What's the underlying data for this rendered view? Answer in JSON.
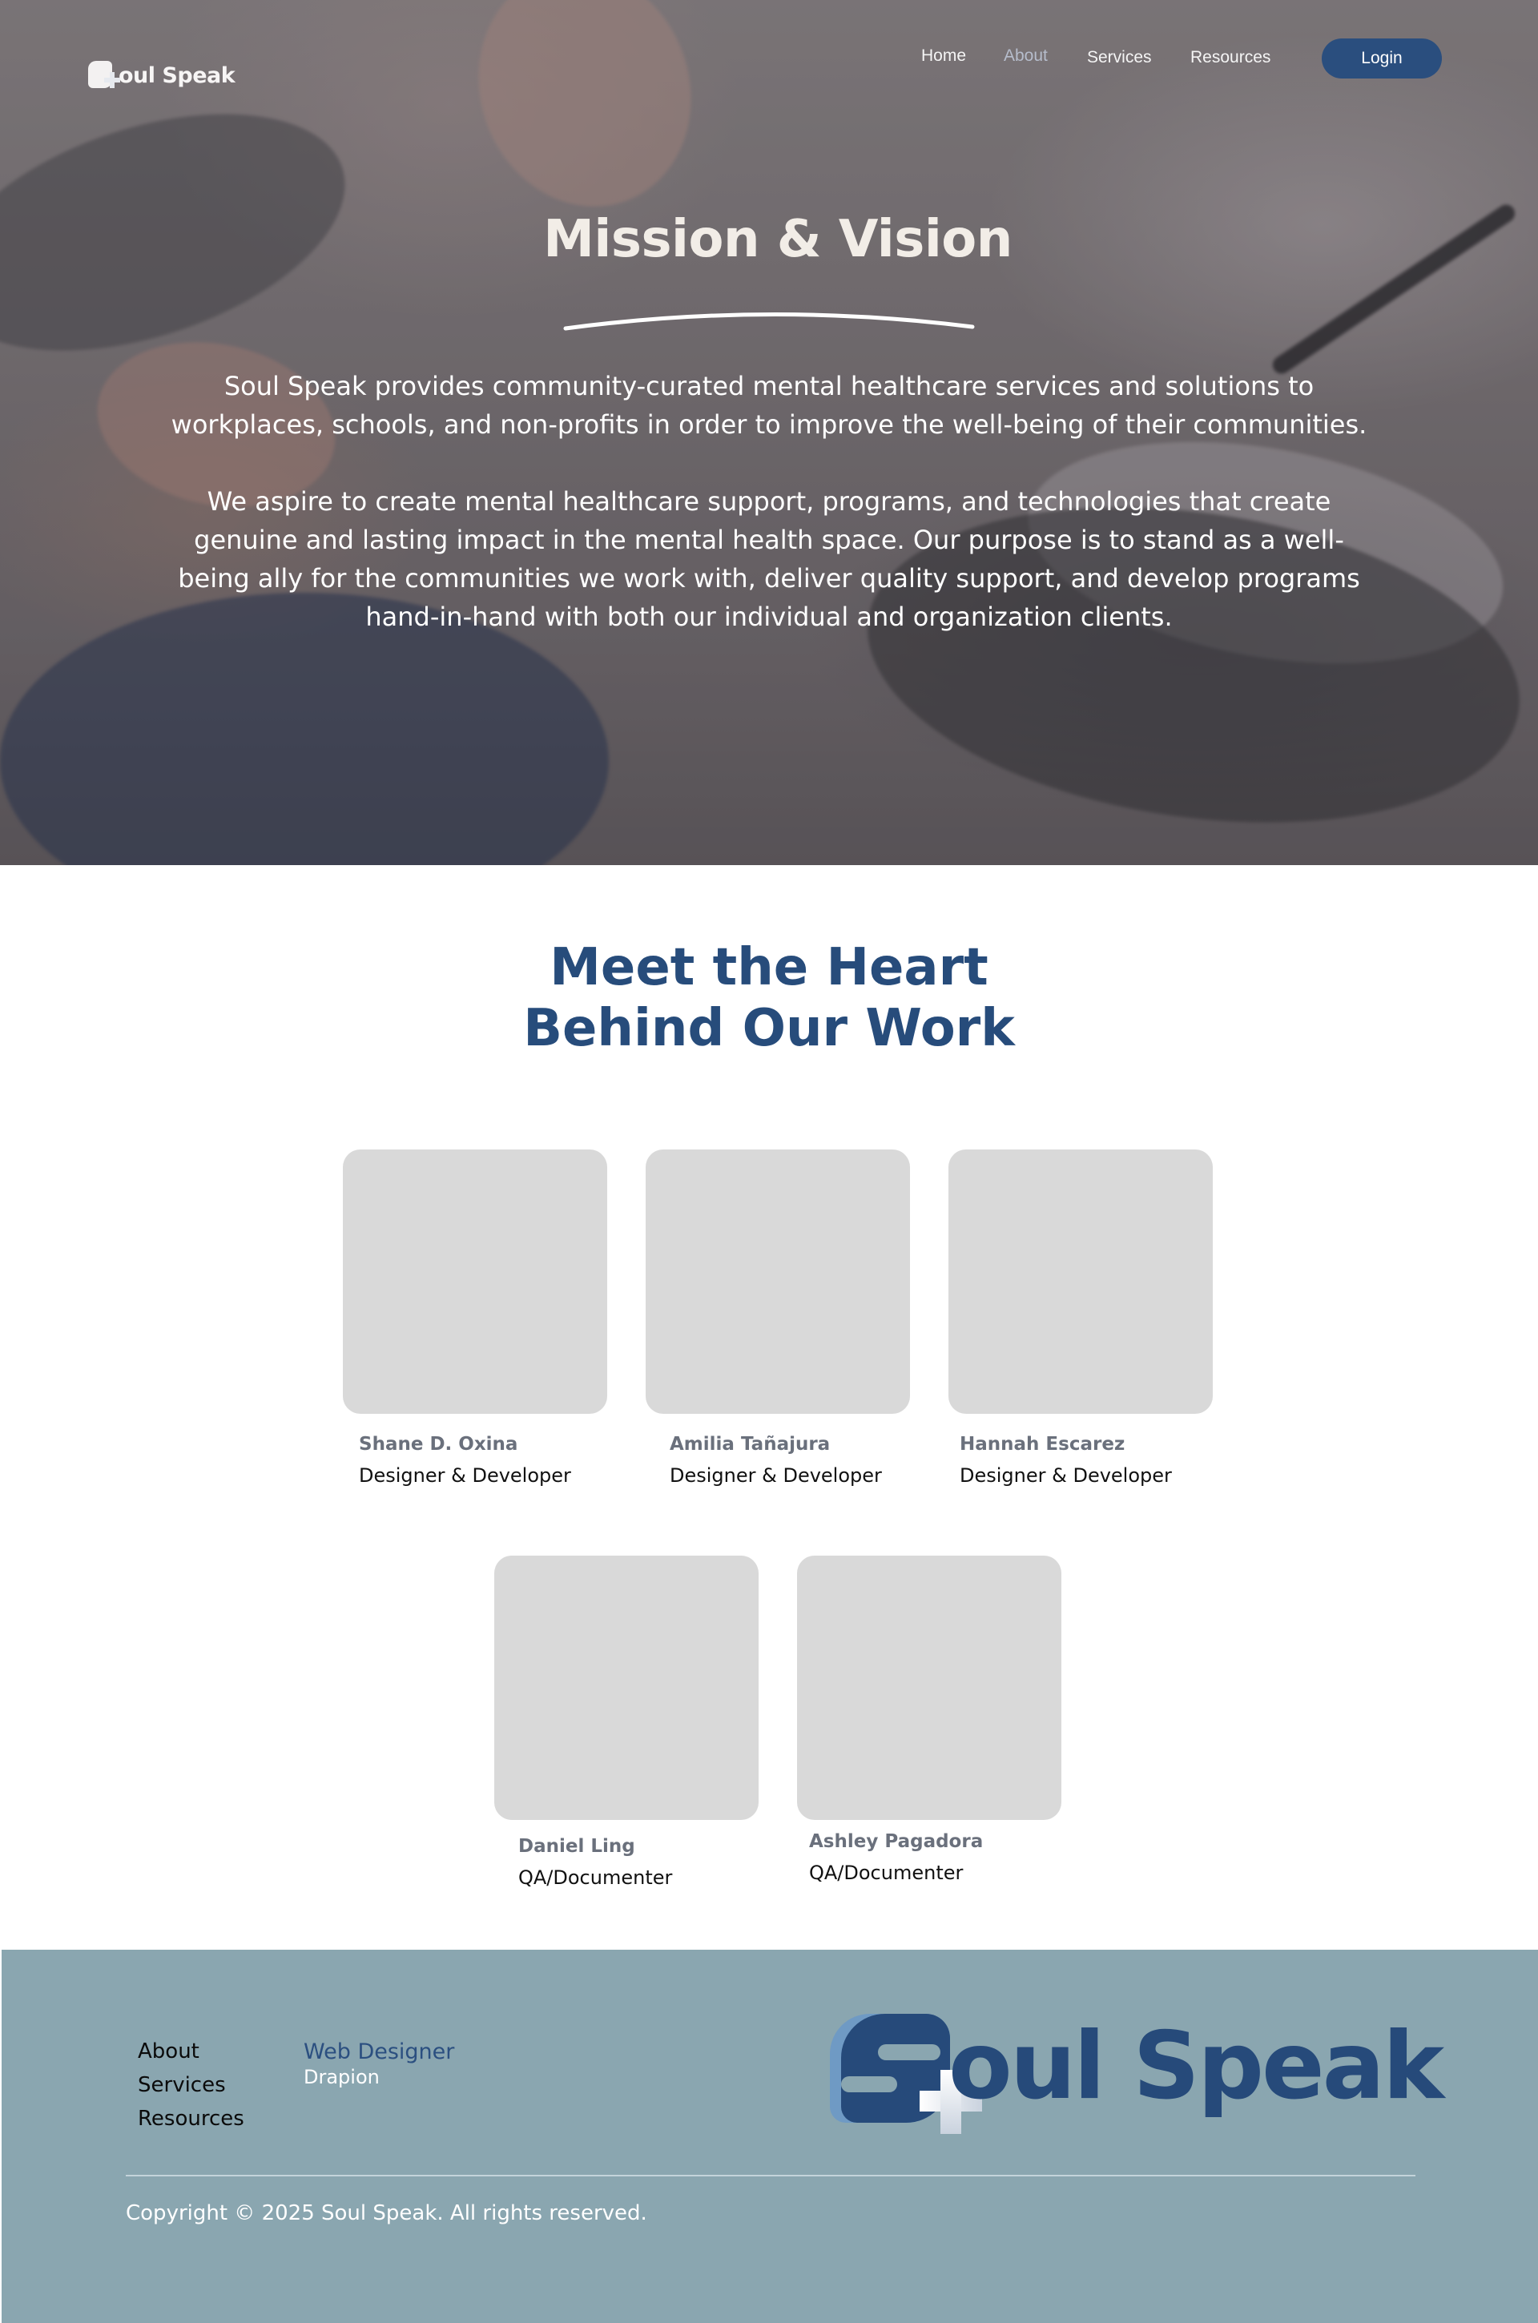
{
  "header": {
    "logo_text": "Soul Speak",
    "nav": [
      {
        "label": "Home"
      },
      {
        "label": "About",
        "active": true
      },
      {
        "label": "Services"
      },
      {
        "label": "Resources"
      }
    ],
    "login_label": "Login"
  },
  "hero": {
    "title": "Mission & Vision",
    "paragraph1": "Soul Speak provides community-curated mental healthcare services and solutions to workplaces, schools, and non-profits in order to improve the well-being of their communities.",
    "paragraph2": "We aspire to create mental healthcare support, programs, and technologies that create genuine and lasting impact in the mental health space. Our purpose is to stand as a well-being ally for the communities we work with, deliver quality support, and develop programs hand-in-hand with both our individual and organization clients."
  },
  "team": {
    "title_line1": "Meet the Heart",
    "title_line2": "Behind Our Work",
    "members": [
      {
        "name": "Shane D. Oxina",
        "role": "Designer & Developer"
      },
      {
        "name": "Amilia Tañajura",
        "role": "Designer & Developer"
      },
      {
        "name": "Hannah Escarez",
        "role": "Designer & Developer"
      },
      {
        "name": "Daniel Ling",
        "role": "QA/Documenter"
      },
      {
        "name": "Ashley Pagadora",
        "role": "QA/Documenter"
      }
    ]
  },
  "footer": {
    "links": [
      {
        "label": "About"
      },
      {
        "label": "Services"
      },
      {
        "label": "Resources"
      }
    ],
    "credit_role": "Web Designer",
    "credit_name": "Drapion",
    "logo_text": "Soul Speak",
    "copyright": "Copyright © 2025 Soul Speak. All rights reserved."
  },
  "colors": {
    "brand_navy": "#274c7b",
    "login_button": "#2a4e7e",
    "footer_bg": "#8aa6b0",
    "photo_placeholder": "#d9d9d9",
    "nav_active": "#b6bdcc"
  }
}
